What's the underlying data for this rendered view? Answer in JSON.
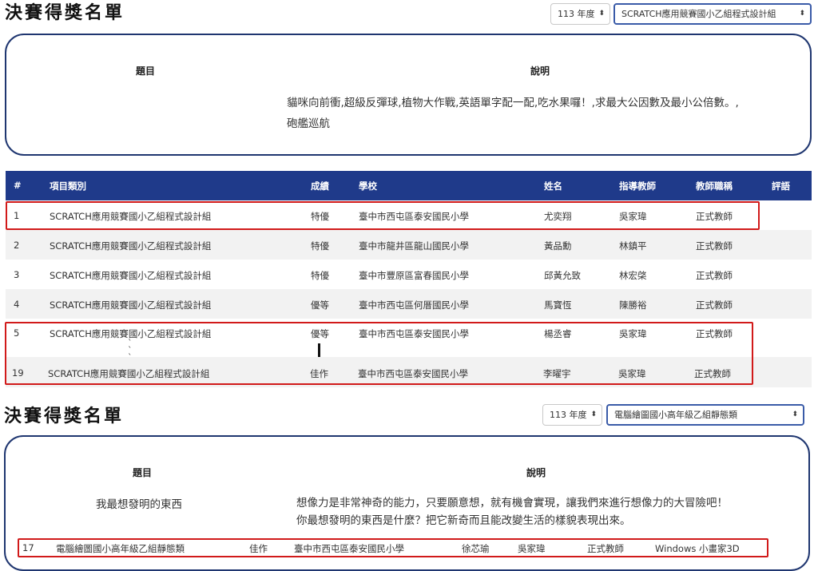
{
  "section1": {
    "heading": "決賽得獎名單",
    "year_select": "113 年度",
    "category_select": "SCRATCH應用競賽國小乙組程式設計組",
    "topic_header": "題目",
    "desc_header": "說明",
    "description_line1": "貓咪向前衝,超級反彈球,植物大作戰,英語單字配一配,吃水果囉！,求最大公因數及最小公倍數。,",
    "description_line2": "砲艦巡航"
  },
  "table": {
    "headers": {
      "num": "#",
      "category": "項目類別",
      "grade": "成績",
      "school": "學校",
      "name": "姓名",
      "teacher": "指導教師",
      "title": "教師職稱",
      "comment": "評語"
    },
    "rows": [
      {
        "num": "1",
        "category": "SCRATCH應用競賽國小乙組程式設計組",
        "grade": "特優",
        "school": "臺中市西屯區泰安國民小學",
        "name": "尤奕翔",
        "teacher": "吳家瑋",
        "title": "正式教師"
      },
      {
        "num": "2",
        "category": "SCRATCH應用競賽國小乙組程式設計組",
        "grade": "特優",
        "school": "臺中市龍井區龍山國民小學",
        "name": "黃品勳",
        "teacher": "林鎮平",
        "title": "正式教師"
      },
      {
        "num": "3",
        "category": "SCRATCH應用競賽國小乙組程式設計組",
        "grade": "特優",
        "school": "臺中市豐原區富春國民小學",
        "name": "邱黃允致",
        "teacher": "林宏棨",
        "title": "正式教師"
      },
      {
        "num": "4",
        "category": "SCRATCH應用競賽國小乙組程式設計組",
        "grade": "優等",
        "school": "臺中市西屯區何厝國民小學",
        "name": "馬寶恆",
        "teacher": "陳勝裕",
        "title": "正式教師"
      },
      {
        "num": "5",
        "category": "SCRATCH應用競賽國小乙組程式設計組",
        "grade": "優等",
        "school": "臺中市西屯區泰安國民小學",
        "name": "楊丞睿",
        "teacher": "吳家瑋",
        "title": "正式教師"
      },
      {
        "num": "19",
        "category": "SCRATCH應用競賽國小乙組程式設計組",
        "grade": "佳作",
        "school": "臺中市西屯區泰安國民小學",
        "name": "李曜宇",
        "teacher": "吳家瑋",
        "title": "正式教師"
      }
    ]
  },
  "section2": {
    "heading": "決賽得獎名單",
    "year_select": "113 年度",
    "category_select": "電腦繪圖國小高年級乙組靜態類",
    "topic_header": "題目",
    "desc_header": "說明",
    "topic": "我最想發明的東西",
    "description_line1": "想像力是非常神奇的能力，只要願意想，就有機會實現，讓我們來進行想像力的大冒險吧！",
    "description_line2": "你最想發明的東西是什麼？把它新奇而且能改變生活的樣貌表現出來。",
    "result_row": {
      "num": "17",
      "category": "電腦繪圖國小高年級乙組靜態類",
      "grade": "佳作",
      "school": "臺中市西屯區泰安國民小學",
      "name": "徐芯瑜",
      "teacher": "吳家瑋",
      "title": "正式教師",
      "comment": "Windows 小畫家3D"
    }
  }
}
